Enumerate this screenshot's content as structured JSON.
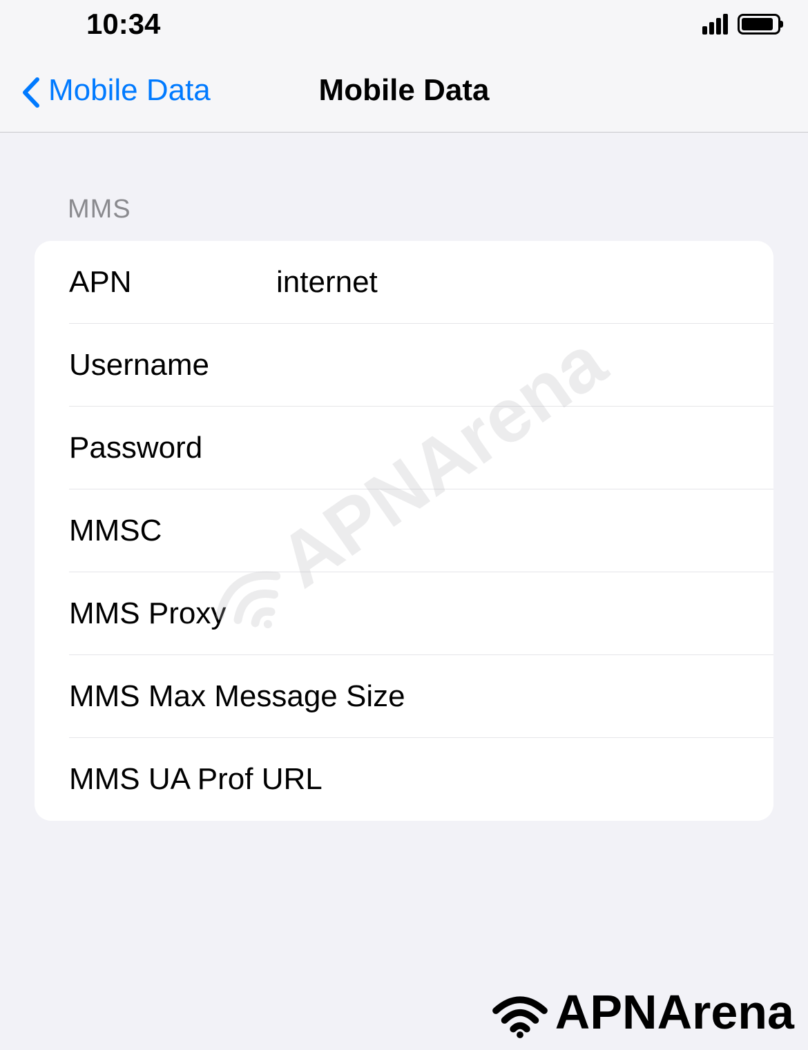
{
  "statusBar": {
    "time": "10:34"
  },
  "navBar": {
    "backLabel": "Mobile Data",
    "title": "Mobile Data"
  },
  "section": {
    "header": "MMS",
    "rows": {
      "apn": {
        "label": "APN",
        "value": "internet"
      },
      "username": {
        "label": "Username",
        "value": ""
      },
      "password": {
        "label": "Password",
        "value": ""
      },
      "mmsc": {
        "label": "MMSC",
        "value": ""
      },
      "mmsProxy": {
        "label": "MMS Proxy",
        "value": ""
      },
      "mmsMaxMessageSize": {
        "label": "MMS Max Message Size",
        "value": ""
      },
      "mmsUaProfUrl": {
        "label": "MMS UA Prof URL",
        "value": ""
      }
    }
  },
  "watermark": "APNArena",
  "footerLogo": "APNArena"
}
